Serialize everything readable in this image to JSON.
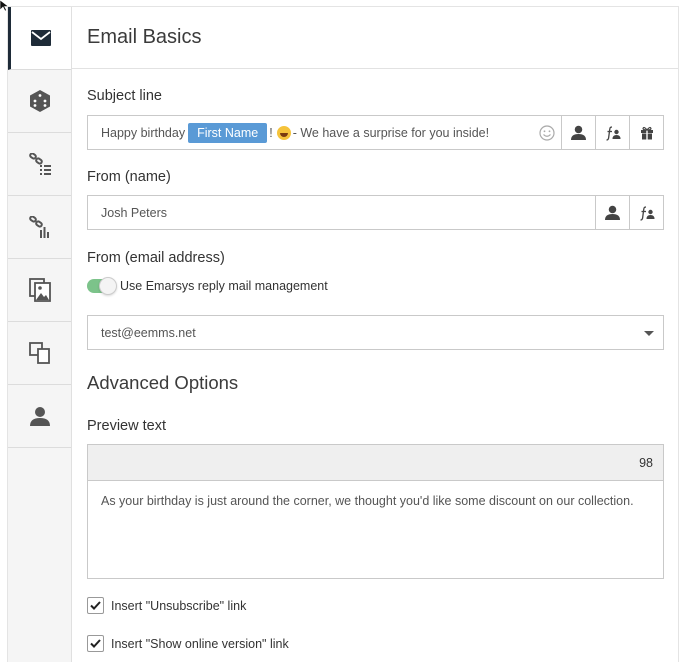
{
  "header": {
    "title": "Email Basics"
  },
  "sidebar": {
    "items": [
      {
        "icon": "envelope-icon",
        "active": true
      },
      {
        "icon": "dice-icon",
        "active": false
      },
      {
        "icon": "link-list-icon",
        "active": false
      },
      {
        "icon": "link-chart-icon",
        "active": false
      },
      {
        "icon": "images-icon",
        "active": false
      },
      {
        "icon": "devices-icon",
        "active": false
      },
      {
        "icon": "person-icon",
        "active": false
      }
    ]
  },
  "subject": {
    "label": "Subject line",
    "text_before": "Happy birthday",
    "token": "First Name",
    "text_after_token": "!",
    "text_after_emoji": "- We have a surprise for you inside!"
  },
  "from_name": {
    "label": "From (name)",
    "value": "Josh Peters"
  },
  "from_email": {
    "label": "From (email address)",
    "toggle_label": "Use Emarsys reply mail management",
    "toggle_on": true,
    "selected": "test@eemms.net"
  },
  "advanced": {
    "title": "Advanced Options",
    "preview_label": "Preview text",
    "char_count": "98",
    "preview_value": "As your birthday is just around the corner, we thought you'd like some discount on our collection."
  },
  "options": {
    "unsubscribe_label": "Insert \"Unsubscribe\" link",
    "online_version_label": "Insert \"Show online version\" link",
    "unsubscribe_checked": true,
    "online_version_checked": true
  },
  "colors": {
    "accent": "#5a9ad6",
    "toggle": "#7cc38a",
    "dark": "#1e2b38"
  }
}
